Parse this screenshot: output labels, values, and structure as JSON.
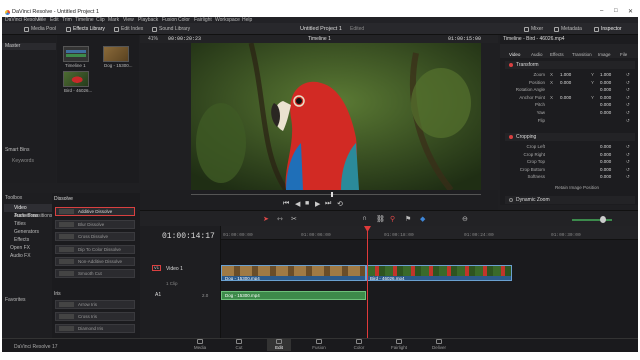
{
  "window": {
    "title": "DaVinci Resolve - Untitled Project 1",
    "controls": [
      "–",
      "□",
      "✕"
    ]
  },
  "menu": [
    "DaVinci Resolve",
    "File",
    "Edit",
    "Trim",
    "Timeline",
    "Clip",
    "Mark",
    "View",
    "Playback",
    "Fusion",
    "Color",
    "Fairlight",
    "Workspace",
    "Help"
  ],
  "toolbar": {
    "media_pool": "Media Pool",
    "effects_library": "Effects Library",
    "edit_index": "Edit Index",
    "sound_library": "Sound Library",
    "project_title": "Untitled Project 1",
    "edited": "Edited",
    "mixer": "Mixer",
    "metadata": "Metadata",
    "inspector": "Inspector"
  },
  "viewer_bar": {
    "zoom": "41%",
    "timecode": "00:00:20:23",
    "timeline_name": "Timeline 1",
    "current_tc": "01:00:15:00"
  },
  "media_pool": {
    "bin": "Master",
    "clips": [
      {
        "name": "Timeline 1"
      },
      {
        "name": "Dog - 15300..."
      },
      {
        "name": "Bird - 46026..."
      }
    ],
    "smart_bins": "Smart Bins",
    "keywords": "Keywords"
  },
  "toolbox": {
    "header": "Toolbox",
    "items": [
      "Video Transitions",
      "Audio Transitions",
      "Titles",
      "Generators",
      "Effects",
      "Open FX",
      "Audio FX"
    ],
    "favorites": "Favorites"
  },
  "effects": {
    "section": "Dissolve",
    "items": [
      "Additive Dissolve",
      "Blur Dissolve",
      "Cross Dissolve",
      "Dip To Color Dissolve",
      "Non-Additive Dissolve",
      "Smooth Cut"
    ],
    "iris_section": "Iris",
    "iris_items": [
      "Arrow Iris",
      "Cross Iris",
      "Diamond Iris"
    ]
  },
  "inspector": {
    "title": "Timeline - Bird - 46026.mp4",
    "tabs": [
      "Video",
      "Audio",
      "Effects",
      "Transition",
      "Image",
      "File"
    ],
    "transform_label": "Transform",
    "transform": [
      {
        "label": "Zoom",
        "x_label": "X",
        "x": "1.000",
        "y_label": "Y",
        "y": "1.000"
      },
      {
        "label": "Position",
        "x_label": "X",
        "x": "0.000",
        "y_label": "Y",
        "y": "0.000"
      },
      {
        "label": "Rotation Angle",
        "x": "0.000"
      },
      {
        "label": "Anchor Point",
        "x_label": "X",
        "x": "0.000",
        "y_label": "Y",
        "y": "0.000"
      },
      {
        "label": "Pitch",
        "x": "0.000"
      },
      {
        "label": "Yaw",
        "x": "0.000"
      },
      {
        "label": "Flip"
      }
    ],
    "cropping_label": "Cropping",
    "cropping": [
      {
        "label": "Crop Left",
        "x": "0.000"
      },
      {
        "label": "Crop Right",
        "x": "0.000"
      },
      {
        "label": "Crop Top",
        "x": "0.000"
      },
      {
        "label": "Crop Bottom",
        "x": "0.000"
      },
      {
        "label": "Softness",
        "x": "0.000"
      }
    ],
    "retain": "Retain Image Position",
    "dynamic_zoom": "Dynamic Zoom"
  },
  "timeline": {
    "timecode": "01:00:14:17",
    "ruler": [
      "01:00:00:00",
      "01:00:06:00",
      "01:00:12:00",
      "01:00:18:00",
      "01:00:24:00",
      "01:00:30:00"
    ],
    "video_track": {
      "id": "V1",
      "name": "Video 1",
      "clips_count": "1 Clip"
    },
    "audio_track": {
      "id": "A1",
      "level": "2.0"
    },
    "clips": {
      "video_a": "Dog - 15300.mp4",
      "video_b": "Bird - 46026.mp4",
      "audio": "Dog - 15300.mp4"
    }
  },
  "pages": [
    "Media",
    "Cut",
    "Edit",
    "Fusion",
    "Color",
    "Fairlight",
    "Deliver"
  ],
  "active_page": "Edit",
  "version": "DaVinci Resolve 17",
  "colors": {
    "accent": "#d94040",
    "clip_video": "#2c5a8a",
    "clip_audio": "#3d8a4a"
  }
}
